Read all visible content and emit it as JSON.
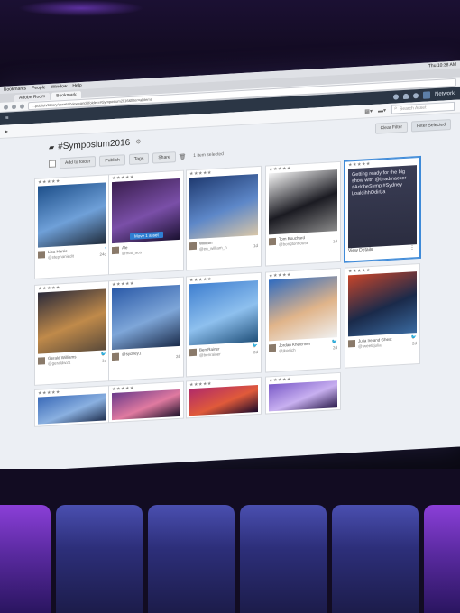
{
  "menubar": {
    "items": [
      "Bookmarks",
      "People",
      "Window",
      "Help"
    ],
    "clock": "Thu 10:38 AM"
  },
  "browser": {
    "tabs": [
      "Adobe Room",
      "Bookmark"
    ],
    "url": "…publish/library/assets?view=grid&folder=#Symposium2016&filter=allitems"
  },
  "app": {
    "network_label": "Network"
  },
  "subheader": {
    "search_placeholder": "Search Asset"
  },
  "page": {
    "title": "#Symposium2016",
    "buttons": {
      "clear_filter": "Clear Filter",
      "filter_selected": "Filter Selected"
    }
  },
  "toolbar": {
    "buttons": [
      "Add to folder",
      "Publish",
      "Tags",
      "Share"
    ],
    "selection_count": "1 item selected"
  },
  "cards": [
    {
      "name": "Lisa Harris",
      "handle": "@stephaniedit",
      "age": "24d",
      "stars": "★★★★★",
      "network": "f",
      "colors": [
        "#1d4f8a",
        "#6fa0d8",
        "#1f2b3a"
      ]
    },
    {
      "name": "Ale",
      "handle": "@mat_aca",
      "age": "",
      "stars": "★★★★★",
      "network": "",
      "pill": "Move 1 asset",
      "colors": [
        "#3a1e4e",
        "#7a4fa8",
        "#1a1030"
      ]
    },
    {
      "name": "William",
      "handle": "@en_william_n",
      "age": "1d",
      "stars": "★★★★★",
      "network": "",
      "colors": [
        "#1f3a70",
        "#5d87c8",
        "#d8c6a8"
      ]
    },
    {
      "name": "Tom Bouchard",
      "handle": "@bongtonhouse",
      "age": "1d",
      "stars": "★★★★★",
      "network": "",
      "colors": [
        "#f4f4f4",
        "#1b1b22",
        "#8a8a8a"
      ]
    },
    {
      "name": "",
      "handle": "",
      "age": "",
      "stars": "★★★★★",
      "network": "",
      "selected": true,
      "overlay": "Getting ready for the big show with @bradmacker #AdobeSymp #Sydney LoaldihhOdirLa",
      "view_details": "View Details"
    },
    {
      "name": "Gerald Williams",
      "handle": "@geraldw21",
      "age": "1d",
      "stars": "★★★★★",
      "network": "t",
      "colors": [
        "#2a2a3a",
        "#c08a4a",
        "#5a4a3a"
      ]
    },
    {
      "name": "@sydney1",
      "handle": "",
      "age": "2d",
      "stars": "★★★★★",
      "network": "",
      "colors": [
        "#2b5aa8",
        "#7ea6d8",
        "#1a2b4a"
      ]
    },
    {
      "name": "Ben Rainer",
      "handle": "@benrainer",
      "age": "2d",
      "stars": "★★★★★",
      "network": "t",
      "colors": [
        "#3f7fd0",
        "#8ec0ee",
        "#20507a"
      ]
    },
    {
      "name": "Jordan Kheichner",
      "handle": "@jkoeich",
      "age": "2d",
      "stars": "★★★★★",
      "network": "t",
      "colors": [
        "#2f6bc0",
        "#e0b48a",
        "#f0f0f0"
      ]
    },
    {
      "name": "Julia Ireland Ghest",
      "handle": "@tweetitjulia",
      "age": "2d",
      "stars": "★★★★★",
      "network": "t",
      "colors": [
        "#c8452a",
        "#1a2a4a",
        "#3a6aa0"
      ]
    },
    {
      "name": "",
      "handle": "",
      "age": "",
      "stars": "★★★★★",
      "network": "",
      "colors": [
        "#3a6ab8",
        "#8ab0e0",
        "#1e2e4e"
      ]
    },
    {
      "name": "",
      "handle": "",
      "age": "",
      "stars": "★★★★★",
      "network": "",
      "colors": [
        "#6a3a8a",
        "#e07aa0",
        "#1a1028"
      ]
    },
    {
      "name": "",
      "handle": "",
      "age": "",
      "stars": "★★★★★",
      "network": "",
      "colors": [
        "#b02a6a",
        "#e05a3a",
        "#1a0a2a"
      ]
    },
    {
      "name": "",
      "handle": "",
      "age": "",
      "stars": "★★★★★",
      "network": "",
      "colors": [
        "#7a5ac8",
        "#c8b0f0",
        "#2a1a4a"
      ]
    }
  ]
}
